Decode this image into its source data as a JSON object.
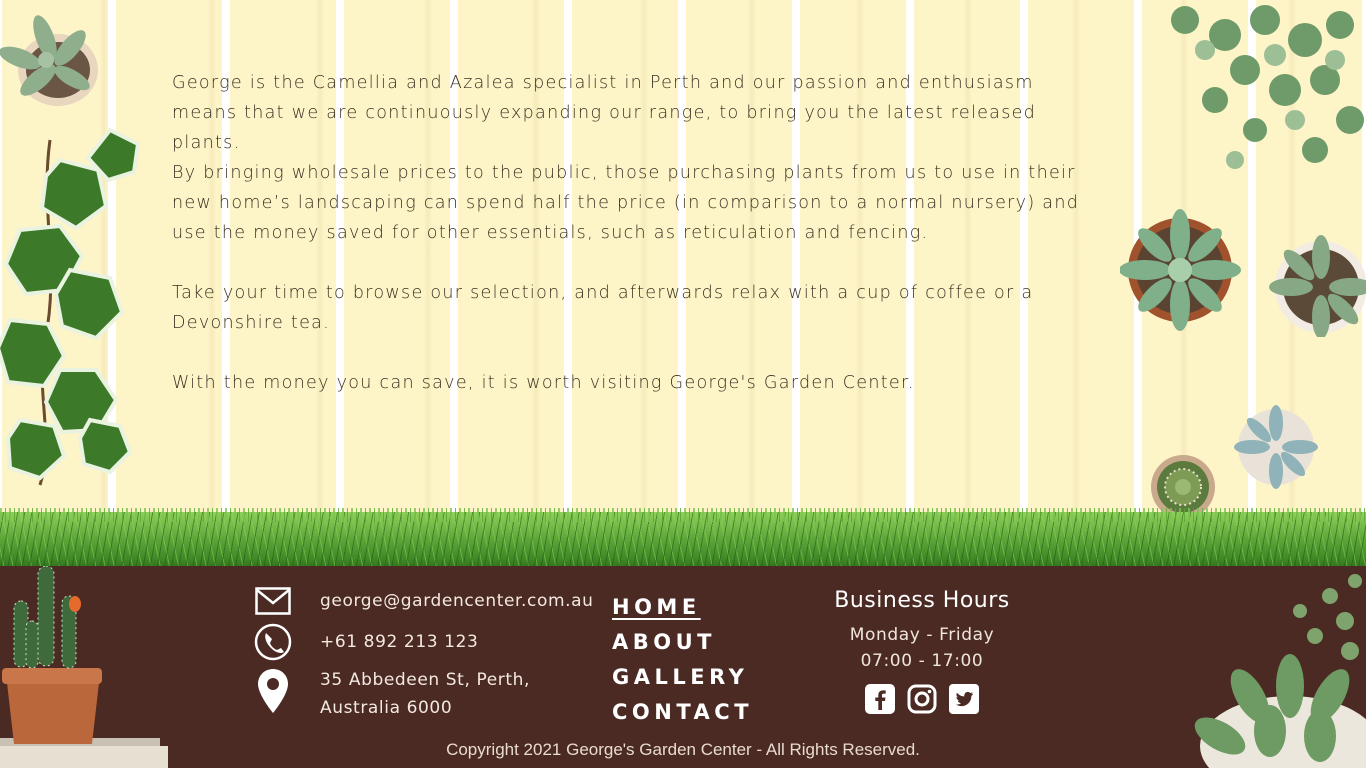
{
  "intro": {
    "paragraph1_line1": "George is the Camellia and Azalea specialist in Perth and our passion and enthusiasm means that we are continuously expanding our range, to bring you the latest released plants.",
    "paragraph1_line2": "By bringing wholesale prices to the public, those purchasing plants from us to use in their new home’s landscaping can spend half the price (in comparison to a normal nursery) and use the money saved for other essentials, such as reticulation and fencing.",
    "paragraph2": "Take your time to browse our selection, and afterwards relax with a cup of coffee or a Devonshire tea.",
    "paragraph3": "With the money you can save, it is worth visiting George's Garden Center."
  },
  "contact": {
    "email": "george@gardencenter.com.au",
    "phone": "+61 892 213 123",
    "address_line1": "35 Abbedeen St, Perth,",
    "address_line2": "Australia 6000",
    "email_icon": "envelope-icon",
    "phone_icon": "phone-icon",
    "address_icon": "map-pin-icon"
  },
  "nav": {
    "items": [
      {
        "label": "HOME",
        "active": true
      },
      {
        "label": "ABOUT",
        "active": false
      },
      {
        "label": "GALLERY",
        "active": false
      },
      {
        "label": "CONTACT",
        "active": false
      }
    ]
  },
  "hours": {
    "title": "Business Hours",
    "days": "Monday - Friday",
    "time": "07:00 - 17:00"
  },
  "social": {
    "icons": [
      "facebook-icon",
      "instagram-icon",
      "twitter-icon"
    ]
  },
  "copyright": "Copyright 2021 George's Garden Center - All Rights Reserved.",
  "colors": {
    "fence": "#fdf4c8",
    "footer": "#4b2a24",
    "grass": "#5ea83a"
  }
}
